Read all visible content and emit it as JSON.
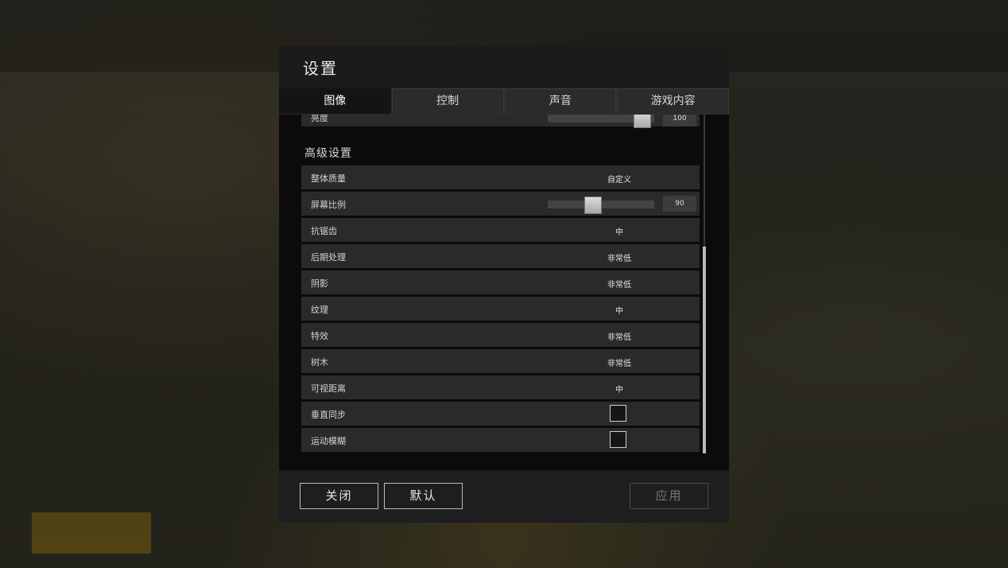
{
  "dialog": {
    "title": "设置"
  },
  "tabs": [
    {
      "label": "图像",
      "active": true
    },
    {
      "label": "控制",
      "active": false
    },
    {
      "label": "声音",
      "active": false
    },
    {
      "label": "游戏内容",
      "active": false
    }
  ],
  "brightness": {
    "label": "亮度",
    "value": "100",
    "fraction": 0.95
  },
  "advanced": {
    "title": "高级设置",
    "overall_quality": {
      "label": "整体质量",
      "value": "自定义"
    },
    "screen_scale": {
      "label": "屏幕比例",
      "value": "90",
      "fraction": 0.4
    },
    "anti_aliasing": {
      "label": "抗锯齿",
      "value": "中"
    },
    "post_processing": {
      "label": "后期处理",
      "value": "非常低"
    },
    "shadows": {
      "label": "阴影",
      "value": "非常低"
    },
    "textures": {
      "label": "纹理",
      "value": "中"
    },
    "effects": {
      "label": "特效",
      "value": "非常低"
    },
    "foliage": {
      "label": "树木",
      "value": "非常低"
    },
    "view_distance": {
      "label": "可视距离",
      "value": "中"
    },
    "vsync": {
      "label": "垂直同步",
      "checked": false
    },
    "motion_blur": {
      "label": "运动模糊",
      "checked": false
    }
  },
  "footer": {
    "close_label": "关闭",
    "default_label": "默认",
    "apply_label": "应用"
  },
  "colors": {
    "panel": "#1b1b1b",
    "row": "#2a2a2a",
    "active_tab": "#141414"
  }
}
